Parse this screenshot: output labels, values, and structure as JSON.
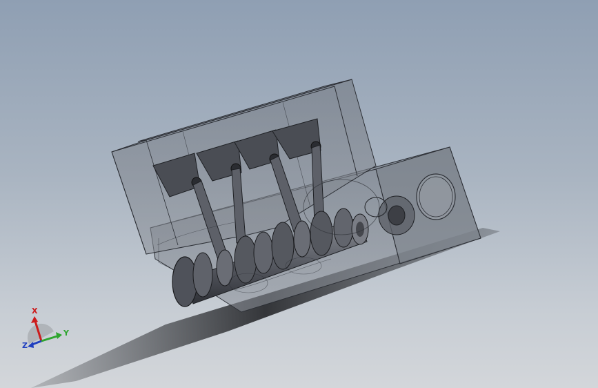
{
  "viewport": {
    "background_top": "#8f9fb3",
    "background_bottom": "#d3d6da",
    "model": "v4-engine-assembly"
  },
  "triad": {
    "x_label": "X",
    "y_label": "Y",
    "z_label": "Z",
    "x_color": "#cc1b1b",
    "y_color": "#2ea52e",
    "z_color": "#1f3fbf"
  },
  "icons": {
    "orientation": "view-triad-icon"
  }
}
